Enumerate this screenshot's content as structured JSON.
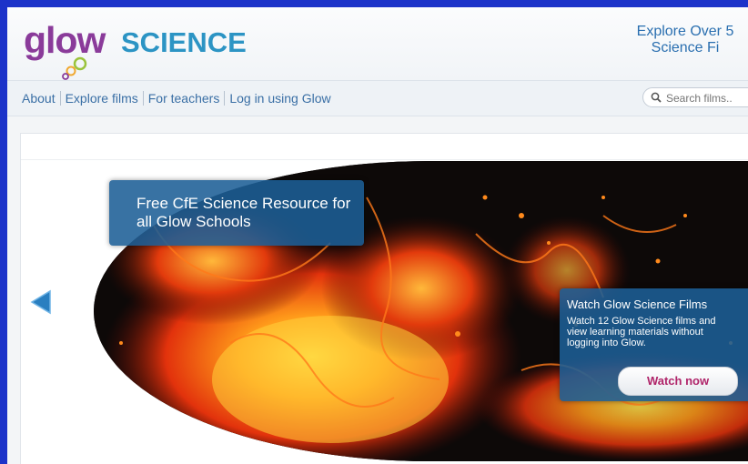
{
  "header": {
    "logo_glow": "glow",
    "logo_science": "SCIENCE",
    "tagline_line1": "Explore Over 5",
    "tagline_line2": "Science Fi"
  },
  "nav": {
    "items": [
      {
        "label": "About"
      },
      {
        "label": "Explore films"
      },
      {
        "label": "For teachers"
      },
      {
        "label": "Log in using Glow"
      }
    ]
  },
  "search": {
    "placeholder": "Search films.."
  },
  "hero": {
    "promo_title": "Free CfE Science Resource for all Glow Schools",
    "watch_title": "Watch Glow Science Films",
    "watch_description": "Watch 12 Glow Science films and view learning materials without logging into Glow.",
    "watch_button": "Watch now"
  },
  "colors": {
    "background": "#1c33c9",
    "logo_purple": "#8a3b9a",
    "logo_blue": "#2c94c4",
    "nav_link": "#3a6fa5",
    "panel_blue": "#1c5f96",
    "button_text": "#b0256a"
  },
  "icons": {
    "search": "search-icon",
    "carousel_prev": "arrow-left-icon"
  }
}
